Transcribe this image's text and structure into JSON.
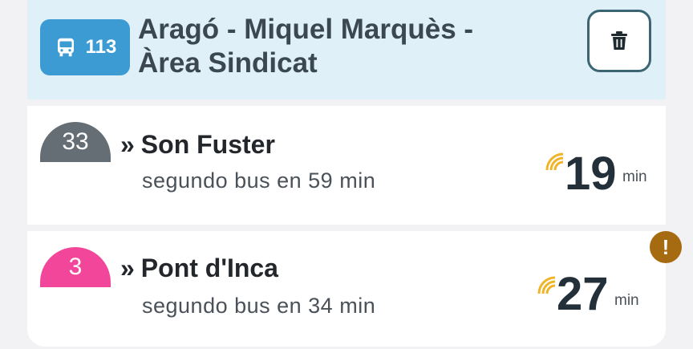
{
  "stop": {
    "number": "113",
    "name": "Aragó - Miquel Marquès - Àrea Sindicat",
    "icon": "bus-icon",
    "delete_icon": "trash-icon"
  },
  "arrivals": [
    {
      "line": "33",
      "line_color": "#646e74",
      "destination": "Son Fuster",
      "arrow": "»",
      "next_bus": "segundo bus en 59 min",
      "eta": "19",
      "unit": "min",
      "realtime_icon": "realtime-signal-icon"
    },
    {
      "line": "3",
      "line_color": "#f2469b",
      "destination": "Pont d'Inca",
      "arrow": "»",
      "next_bus": "segundo bus en 34 min",
      "eta": "27",
      "unit": "min",
      "realtime_icon": "realtime-signal-icon"
    }
  ],
  "alert": {
    "symbol": "!",
    "color": "#a66a10"
  },
  "colors": {
    "header_bg": "#dff0f8",
    "stop_badge": "#3d9bd4",
    "realtime": "#f0b429"
  }
}
